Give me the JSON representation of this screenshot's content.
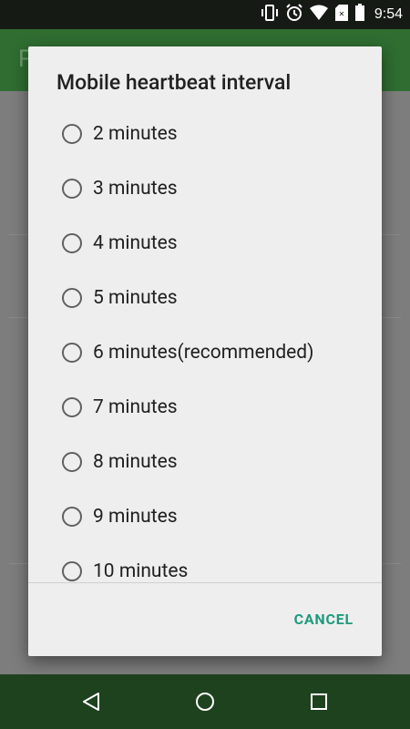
{
  "status_bar": {
    "time": "9:54",
    "icons": [
      "vibrate-icon",
      "alarm-icon",
      "wifi-icon",
      "no-sim-icon",
      "battery-icon"
    ]
  },
  "app": {
    "title_initial": "P"
  },
  "dialog": {
    "title": "Mobile heartbeat interval",
    "options": [
      {
        "label": "2 minutes",
        "selected": false
      },
      {
        "label": "3 minutes",
        "selected": false
      },
      {
        "label": "4 minutes",
        "selected": false
      },
      {
        "label": "5 minutes",
        "selected": false
      },
      {
        "label": "6 minutes(recommended)",
        "selected": false
      },
      {
        "label": "7 minutes",
        "selected": false
      },
      {
        "label": "8 minutes",
        "selected": false
      },
      {
        "label": "9 minutes",
        "selected": false
      },
      {
        "label": "10 minutes",
        "selected": false
      }
    ],
    "cancel_label": "CANCEL"
  },
  "colors": {
    "accent": "#1e9a7e",
    "appbar": "#2f6d31",
    "navbar": "#1e421e"
  }
}
